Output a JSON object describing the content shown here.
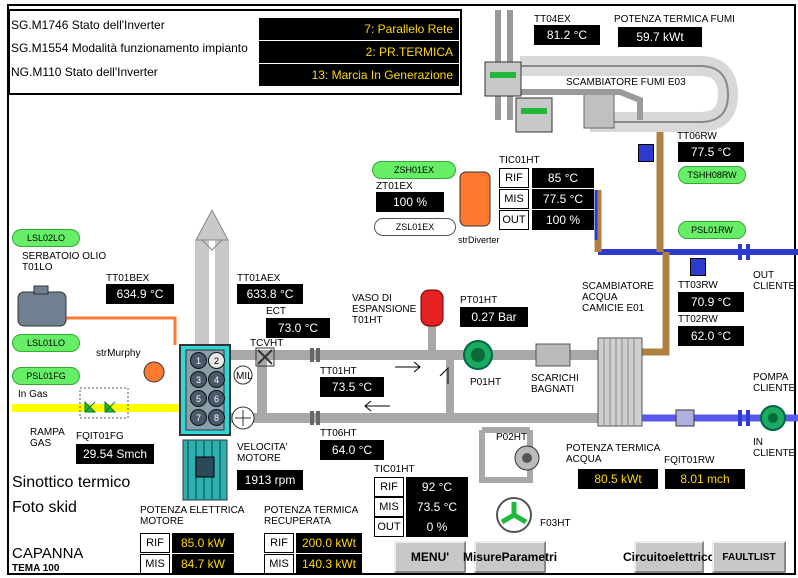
{
  "status_panel": {
    "rows": [
      {
        "label": "SG.M1746 Stato dell'Inverter",
        "value": "7: Parallelo Rete"
      },
      {
        "label": "SG.M1554 Modalità funzionamento impianto",
        "value": "2: PR.TERMICA"
      },
      {
        "label": "NG.M110 Stato dell'Inverter",
        "value": "13: Marcia In Generazione"
      }
    ]
  },
  "fumi": {
    "tt04ex_label": "TT04EX",
    "tt04ex_value": "81.2 °C",
    "potenza_label": "POTENZA TERMICA FUMI",
    "potenza_value": "59.7 kWt",
    "scambiatore_label": "SCAMBIATORE FUMI E03",
    "tt06rw_label": "TT06RW",
    "tt06rw_value": "77.5 °C",
    "tshh08rw": "TSHH08RW"
  },
  "tic01ht_top": {
    "title": "TIC01HT",
    "rows": [
      {
        "label": "RIF",
        "value": "85 °C"
      },
      {
        "label": "MIS",
        "value": "77.5 °C"
      },
      {
        "label": "OUT",
        "value": "100 %"
      }
    ]
  },
  "diverter": {
    "zsh01ex": "ZSH01EX",
    "zt01ex_label": "ZT01EX",
    "zt01ex_value": "100 %",
    "zsl01ex": "ZSL01EX",
    "name": "strDiverter"
  },
  "left": {
    "lsl02lo": "LSL02LO",
    "serbatoio_l1": "SERBATOIO OLIO",
    "serbatoio_l2": "T01LO",
    "lsl01lo": "LSL01LO",
    "psl01fg": "PSL01FG",
    "in_gas": "In Gas",
    "strmurphy": "strMurphy",
    "rampa_l1": "RAMPA",
    "rampa_l2": "GAS",
    "fqit01fg_label": "FQIT01FG",
    "fqit01fg_value": "29.54 Smch",
    "sinottico": "Sinottico termico",
    "foto": "Foto skid",
    "capanna": "CAPANNA",
    "tema": "TEMA 100"
  },
  "engine": {
    "tt01bex_label": "TT01BEX",
    "tt01bex_value": "634.9 °C",
    "tt01aex_label": "TT01AEX",
    "tt01aex_value": "633.8 °C",
    "ect_label": "ECT",
    "ect_value": "73.0 °C",
    "tcvht": "TCVHT",
    "mil": "MIL",
    "velocita_l1": "VELOCITA'",
    "velocita_l2": "MOTORE",
    "velocita_value": "1913 rpm",
    "cylinders": [
      "1",
      "2",
      "3",
      "4",
      "5",
      "6",
      "7",
      "8"
    ]
  },
  "circuit": {
    "vaso_l1": "VASO DI",
    "vaso_l2": "ESPANSIONE",
    "vaso_l3": "T01HT",
    "pt01ht_label": "PT01HT",
    "pt01ht_value": "0.27 Bar",
    "tt01ht_label": "TT01HT",
    "tt01ht_value": "73.5 °C",
    "tt06ht_label": "TT06HT",
    "tt06ht_value": "64.0 °C",
    "p01ht": "P01HT",
    "scarichi_l1": "SCARICHI",
    "scarichi_l2": "BAGNATI",
    "p02ht": "P02HT",
    "f03ht": "F03HT"
  },
  "tic01ht_bottom": {
    "title": "TIC01HT",
    "rows": [
      {
        "label": "RIF",
        "value": "92 °C"
      },
      {
        "label": "MIS",
        "value": "73.5 °C"
      },
      {
        "label": "OUT",
        "value": "0 %"
      }
    ]
  },
  "right": {
    "psl01rw": "PSL01RW",
    "out_l1": "OUT",
    "out_l2": "CLIENTE",
    "scamb_l1": "SCAMBIATORE",
    "scamb_l2": "ACQUA",
    "scamb_l3": "CAMICIE E01",
    "tt03rw_label": "TT03RW",
    "tt03rw_value": "70.9 °C",
    "tt02rw_label": "TT02RW",
    "tt02rw_value": "62.0 °C",
    "pompa_l1": "POMPA",
    "pompa_l2": "CLIENTE",
    "in_l1": "IN",
    "in_l2": "CLIENTE",
    "potenza_acqua_l1": "POTENZA TERMICA",
    "potenza_acqua_l2": "ACQUA",
    "potenza_acqua_value": "80.5 kWt",
    "fqit01rw_label": "FQIT01RW",
    "fqit01rw_value": "8.01 mch"
  },
  "power": {
    "motore_l1": "POTENZA ELETTRICA",
    "motore_l2": "MOTORE",
    "motore_rows": [
      {
        "label": "RIF",
        "value": "85.0 kW"
      },
      {
        "label": "MIS",
        "value": "84.7 kW"
      }
    ],
    "recup_l1": "POTENZA TERMICA",
    "recup_l2": "RECUPERATA",
    "recup_rows": [
      {
        "label": "RIF",
        "value": "200.0 kWt"
      },
      {
        "label": "MIS",
        "value": "140.3 kWt"
      }
    ]
  },
  "nav": {
    "menu": "MENU'",
    "misure_l1": "Misure",
    "misure_l2": "Parametri",
    "circuito_l1": "Circuito",
    "circuito_l2": "elettrico",
    "faultlist": "FAULTLIST"
  },
  "colors": {
    "pipe": "#a0a0a0",
    "oil": "#ff7a30",
    "gas": "#ffff00",
    "client": "#2d3bcc",
    "fumi": "#b08040",
    "led_green": "#66ee66",
    "valve_green": "#1fb83a"
  }
}
